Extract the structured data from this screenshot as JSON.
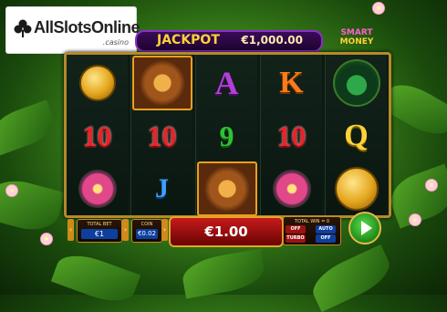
{
  "logo": {
    "text_main": "AllSlotsOnline",
    "text_sub": ".casino"
  },
  "jackpot": {
    "label": "JACKPOT",
    "value": "€1,000.00"
  },
  "smart_money": {
    "line1": "SMART",
    "line2": "MONEY"
  },
  "reels": [
    [
      "coin",
      "10",
      "flower"
    ],
    [
      "monkey",
      "10",
      "J"
    ],
    [
      "A",
      "9",
      "monkey"
    ],
    [
      "K",
      "10",
      "flower"
    ],
    [
      "frog",
      "Q",
      "coin"
    ]
  ],
  "controls": {
    "total_bet_label": "TOTAL BET",
    "total_bet_value": "€1",
    "coin_label": "COIN",
    "coin_value": "€0.02",
    "spin_amount": "€1.00",
    "total_win_label": "TOTAL WIN = 0",
    "off_label": "OFF",
    "turbo_label": "TURBO",
    "auto_label": "AUTO",
    "auto_off_label": "OFF"
  },
  "colors": {
    "accent_gold": "#b38a2a",
    "jackpot_purple": "#8b2fc9",
    "spin_green": "#1c8a18",
    "bet_red": "#c61a1a"
  }
}
